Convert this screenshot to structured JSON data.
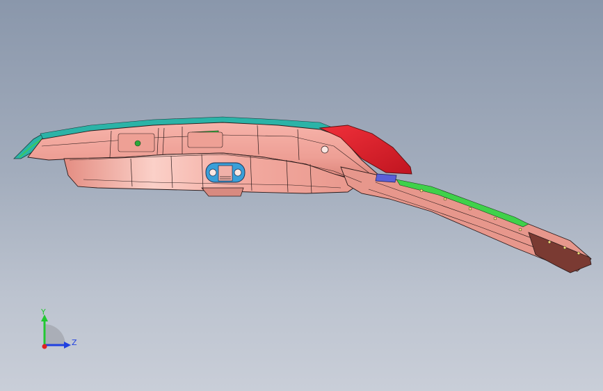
{
  "viewport": {
    "background_top": "#8a97ab",
    "background_bottom": "#c9ced8"
  },
  "model": {
    "part_color": "#f0a39a",
    "accent_red": "#e0202a",
    "accent_green": "#3fd14a",
    "accent_blue": "#3a9fd8",
    "accent_cyan": "#2bb3a7",
    "edge_color": "#2a1a1a"
  },
  "triad": {
    "y_label": "Y",
    "z_label": "Z",
    "y_color": "#22c832",
    "z_color": "#2040e0",
    "x_color": "#e02020"
  }
}
